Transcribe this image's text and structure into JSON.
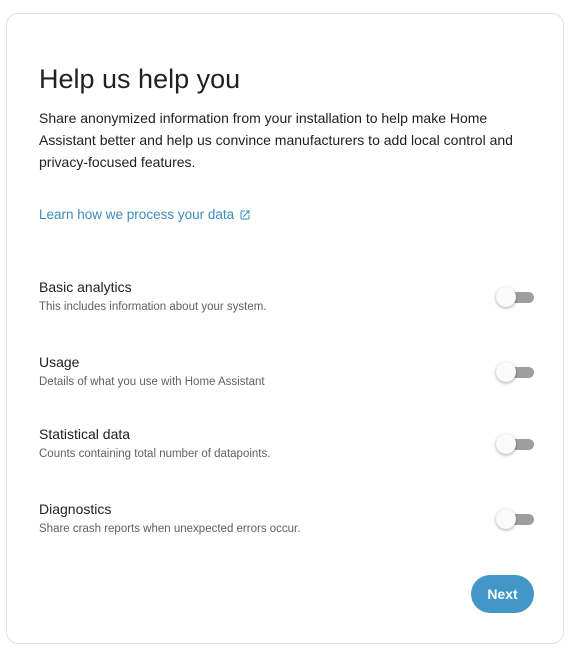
{
  "title": "Help us help you",
  "description": "Share anonymized information from your installation to help make Home Assistant better and help us convince manufacturers to add local control and privacy-focused features.",
  "learn_link": {
    "label": "Learn how we process your data",
    "icon": "open-in-new-icon"
  },
  "options": [
    {
      "label": "Basic analytics",
      "description": "This includes information about your system.",
      "enabled": false
    },
    {
      "label": "Usage",
      "description": "Details of what you use with Home Assistant",
      "enabled": false
    },
    {
      "label": "Statistical data",
      "description": "Counts containing total number of datapoints.",
      "enabled": false
    },
    {
      "label": "Diagnostics",
      "description": "Share crash reports when unexpected errors occur.",
      "enabled": false
    }
  ],
  "next_button": {
    "label": "Next"
  },
  "colors": {
    "accent": "#3b8dbd",
    "button": "#4397c8",
    "switch_track_off": "#9e9e9e",
    "text": "#212121",
    "secondary_text": "#616161"
  }
}
